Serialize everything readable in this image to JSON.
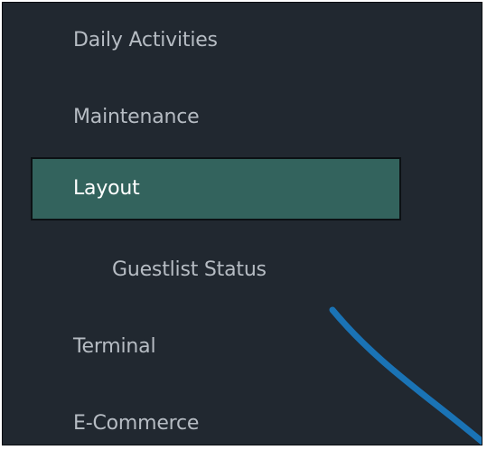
{
  "sidebar": {
    "items": [
      {
        "label": "Daily Activities"
      },
      {
        "label": "Maintenance"
      },
      {
        "label": "Layout",
        "active": true
      },
      {
        "label": "Guestlist Status",
        "sub": true
      },
      {
        "label": "Terminal"
      },
      {
        "label": "E-Commerce"
      }
    ]
  },
  "colors": {
    "background": "#212830",
    "active_item": "#33635d",
    "text": "#b6bcc3",
    "annotation_arrow": "#1a73b5"
  }
}
